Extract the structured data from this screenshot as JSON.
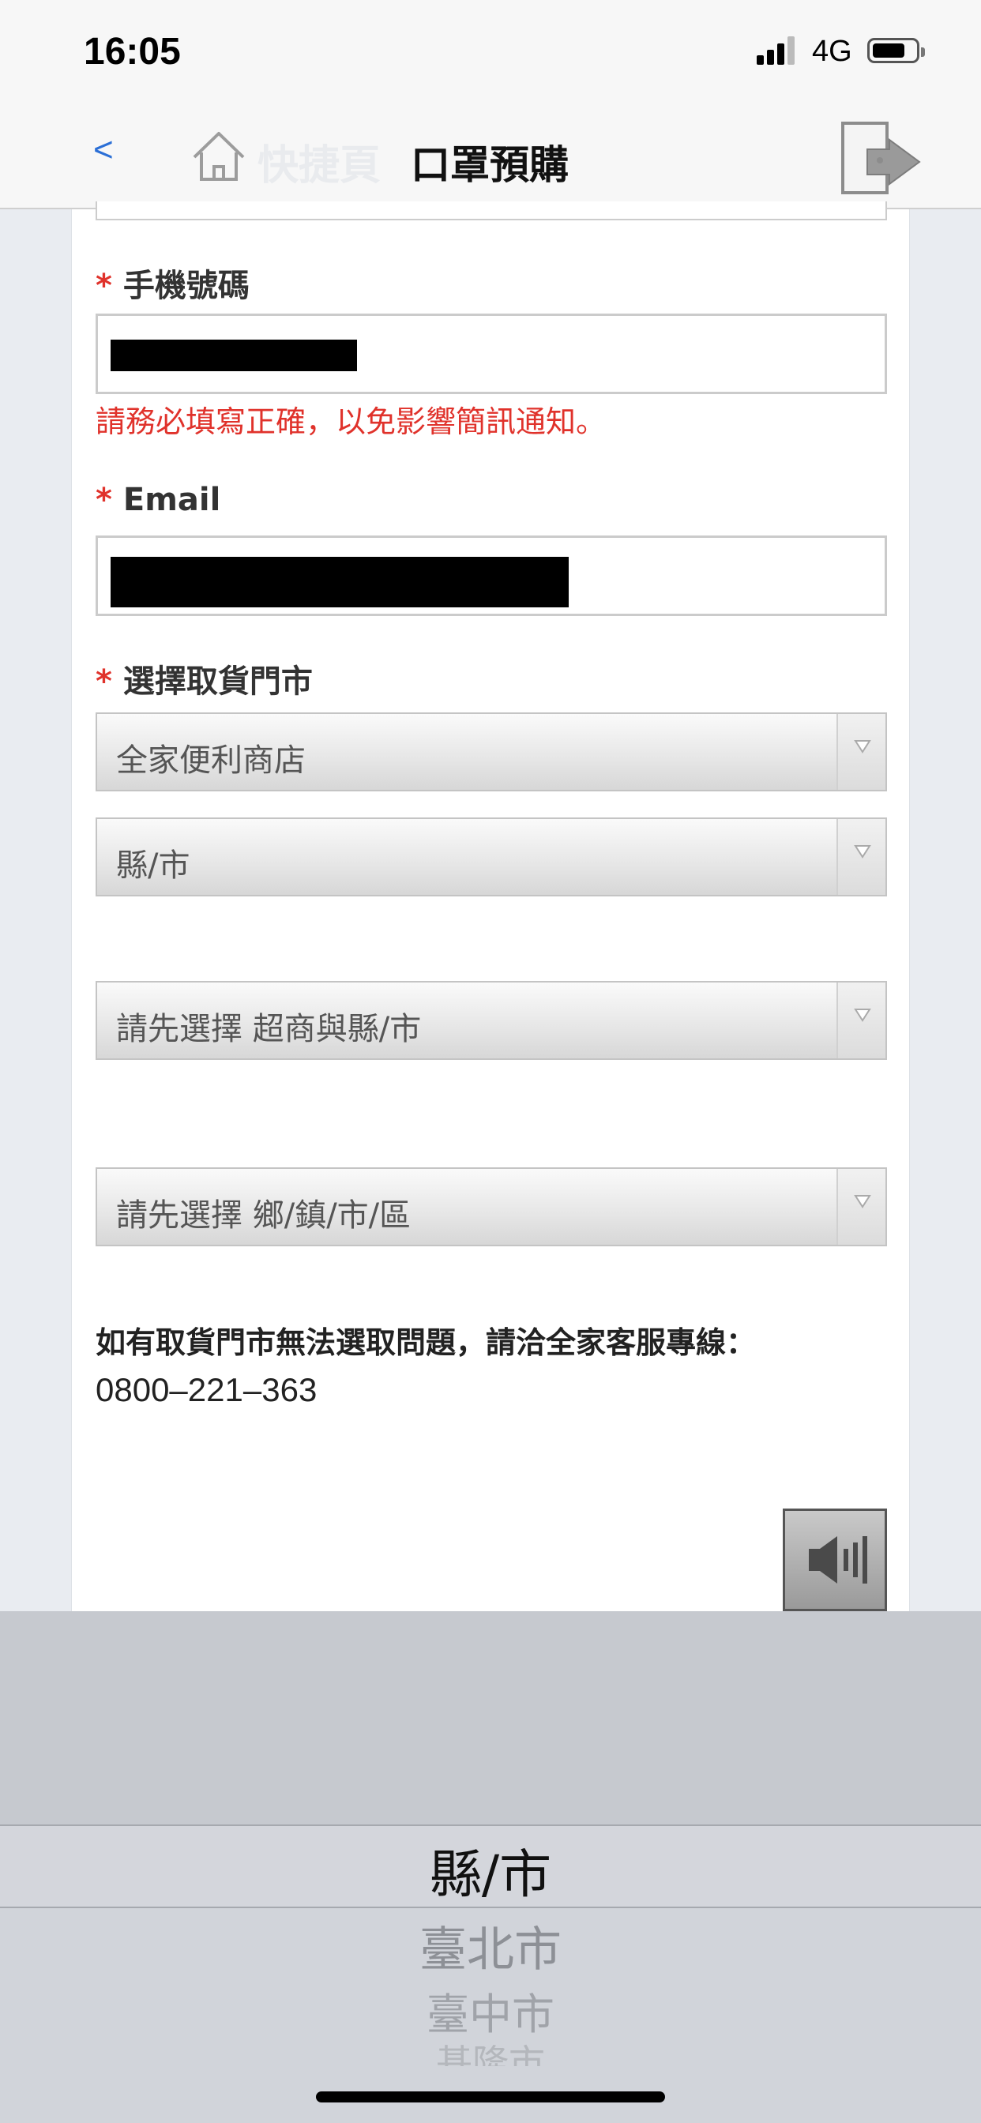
{
  "status": {
    "time": "16:05",
    "network": "4G"
  },
  "nav": {
    "back_label": "<",
    "home_label": "快捷頁",
    "title": "口罩預購"
  },
  "form": {
    "phone": {
      "required_mark": "*",
      "label": "手機號碼",
      "hint": "請務必填寫正確，以免影響簡訊通知。"
    },
    "email": {
      "required_mark": "*",
      "label": "Email"
    },
    "store": {
      "required_mark": "*",
      "label": "選擇取貨門市",
      "chain_select": "全家便利商店",
      "city_select": "縣/市",
      "store_select": "請先選擇 超商與縣/市",
      "district_select": "請先選擇 鄉/鎮/市/區"
    },
    "info": {
      "text": "如有取貨門市無法選取問題，請洽全家客服專線：",
      "phone": "0800–221–363"
    }
  },
  "picker": {
    "selected": "縣/市",
    "options": [
      "臺北市",
      "臺中市",
      "基隆市"
    ]
  },
  "colors": {
    "required": "#e0322b",
    "back_link": "#2b6fd6"
  }
}
